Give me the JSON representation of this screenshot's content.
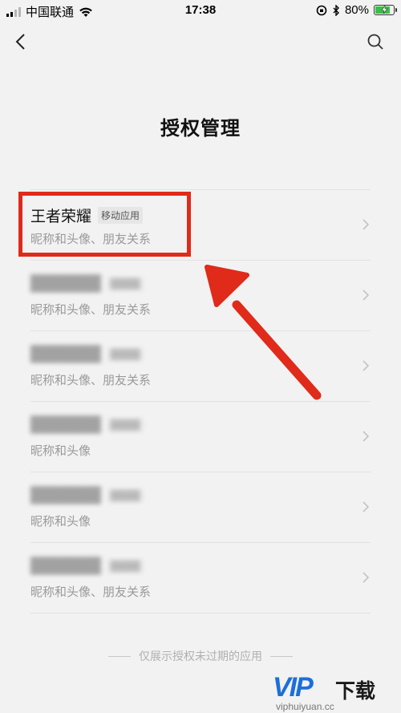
{
  "status_bar": {
    "carrier": "中国联通",
    "time": "17:38",
    "battery": "80%",
    "battery_level": 0.8
  },
  "header": {
    "back_icon": "chevron-left-icon",
    "search_icon": "search-icon",
    "title": "授权管理"
  },
  "apps": [
    {
      "name": "王者荣耀",
      "tag": "移动应用",
      "permissions": "昵称和头像、朋友关系",
      "blurred": false
    },
    {
      "name": "",
      "tag": "",
      "permissions": "昵称和头像、朋友关系",
      "blurred": true
    },
    {
      "name": "",
      "tag": "",
      "permissions": "昵称和头像、朋友关系",
      "blurred": true
    },
    {
      "name": "",
      "tag": "",
      "permissions": "昵称和头像",
      "blurred": true
    },
    {
      "name": "",
      "tag": "",
      "permissions": "昵称和头像",
      "blurred": true
    },
    {
      "name": "",
      "tag": "",
      "permissions": "昵称和头像、朋友关系",
      "blurred": true
    }
  ],
  "footer": {
    "note": "仅展示授权未过期的应用"
  },
  "annotation": {
    "color": "#e02a1a"
  },
  "watermark": {
    "brand": "VIP",
    "suffix": "下载",
    "url": "viphuiyuan.cc"
  }
}
